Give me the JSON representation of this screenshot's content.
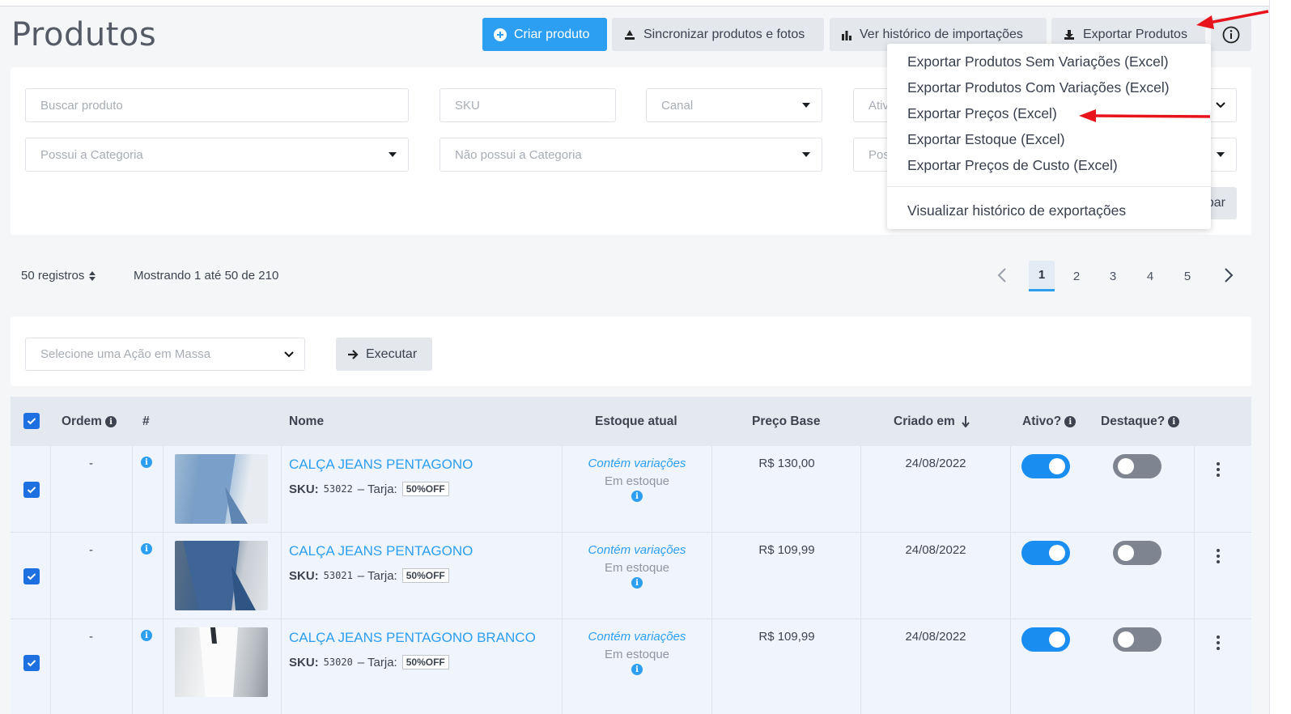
{
  "page": {
    "title": "Produtos",
    "buttons": {
      "create": "Criar produto",
      "sync": "Sincronizar produtos e fotos",
      "import_history": "Ver histórico de importações",
      "export": "Exportar Produtos"
    }
  },
  "filters": {
    "search_placeholder": "Buscar produto",
    "sku_placeholder": "SKU",
    "channel_placeholder": "Canal",
    "active_placeholder": "Ativ",
    "has_category_placeholder": "Possui a Categoria",
    "not_category_placeholder": "Não possui a Categoria",
    "pos_placeholder": "Pos",
    "clear_partial": "par"
  },
  "export_menu": {
    "items": [
      "Exportar Produtos Sem Variações (Excel)",
      "Exportar Produtos Com Variações (Excel)",
      "Exportar Preços (Excel)",
      "Exportar Estoque (Excel)",
      "Exportar Preços de Custo (Excel)"
    ],
    "history": "Visualizar histórico de exportações"
  },
  "pagination": {
    "per_page": "50 registros",
    "showing": "Mostrando 1 até 50 de 210",
    "pages": [
      "1",
      "2",
      "3",
      "4",
      "5"
    ],
    "current": "1"
  },
  "bulk": {
    "select_placeholder": "Selecione uma Ação em Massa",
    "execute": "Executar"
  },
  "table": {
    "headers": {
      "order": "Ordem",
      "hash": "#",
      "name": "Nome",
      "stock": "Estoque atual",
      "price": "Preço Base",
      "created": "Criado em",
      "active": "Ativo?",
      "featured": "Destaque?"
    },
    "labels": {
      "sku": "SKU:",
      "tarja": "– Tarja:",
      "variations": "Contém variações",
      "in_stock": "Em estoque"
    },
    "rows": [
      {
        "order": "-",
        "name": "CALÇA JEANS PENTAGONO",
        "sku": "53022",
        "tag": "50%OFF",
        "price": "R$ 130,00",
        "date": "24/08/2022",
        "active": true,
        "featured": false
      },
      {
        "order": "-",
        "name": "CALÇA JEANS PENTAGONO",
        "sku": "53021",
        "tag": "50%OFF",
        "price": "R$ 109,99",
        "date": "24/08/2022",
        "active": true,
        "featured": false
      },
      {
        "order": "-",
        "name": "CALÇA JEANS PENTAGONO BRANCO",
        "sku": "53020",
        "tag": "50%OFF",
        "price": "R$ 109,99",
        "date": "24/08/2022",
        "active": true,
        "featured": false
      }
    ]
  },
  "colors": {
    "primary": "#2d9ff2",
    "checkbox": "#1e6fe0",
    "toggle_on": "#1a8ef0",
    "toggle_off": "#7f8590",
    "annotation_arrow": "#e8141c"
  }
}
